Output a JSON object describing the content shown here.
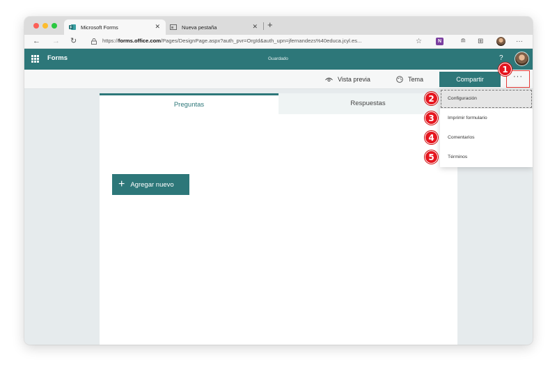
{
  "browser": {
    "tabs": [
      {
        "title": "Microsoft Forms",
        "icon": "forms-icon"
      },
      {
        "title": "Nueva pestaña",
        "icon": "newtab-page-icon"
      }
    ],
    "url_prefix": "https://",
    "url_domain": "forms.office.com",
    "url_path": "/Pages/DesignPage.aspx?auth_pvr=OrgId&auth_upn=jfernandezs%40educa.jcyl.es..."
  },
  "header": {
    "app_name": "Forms",
    "status": "Guardado",
    "help": "?"
  },
  "commands": {
    "preview": "Vista previa",
    "theme": "Tema",
    "share": "Compartir",
    "more": "···"
  },
  "form": {
    "tabs": [
      "Preguntas",
      "Respuestas"
    ],
    "add_new": "Agregar nuevo"
  },
  "menu": {
    "items": [
      "Configuración",
      "Imprimir formulario",
      "Comentarios",
      "Términos"
    ]
  },
  "callouts": [
    "1",
    "2",
    "3",
    "4",
    "5"
  ],
  "colors": {
    "brand": "#2d7779",
    "callout": "#e5161f"
  }
}
